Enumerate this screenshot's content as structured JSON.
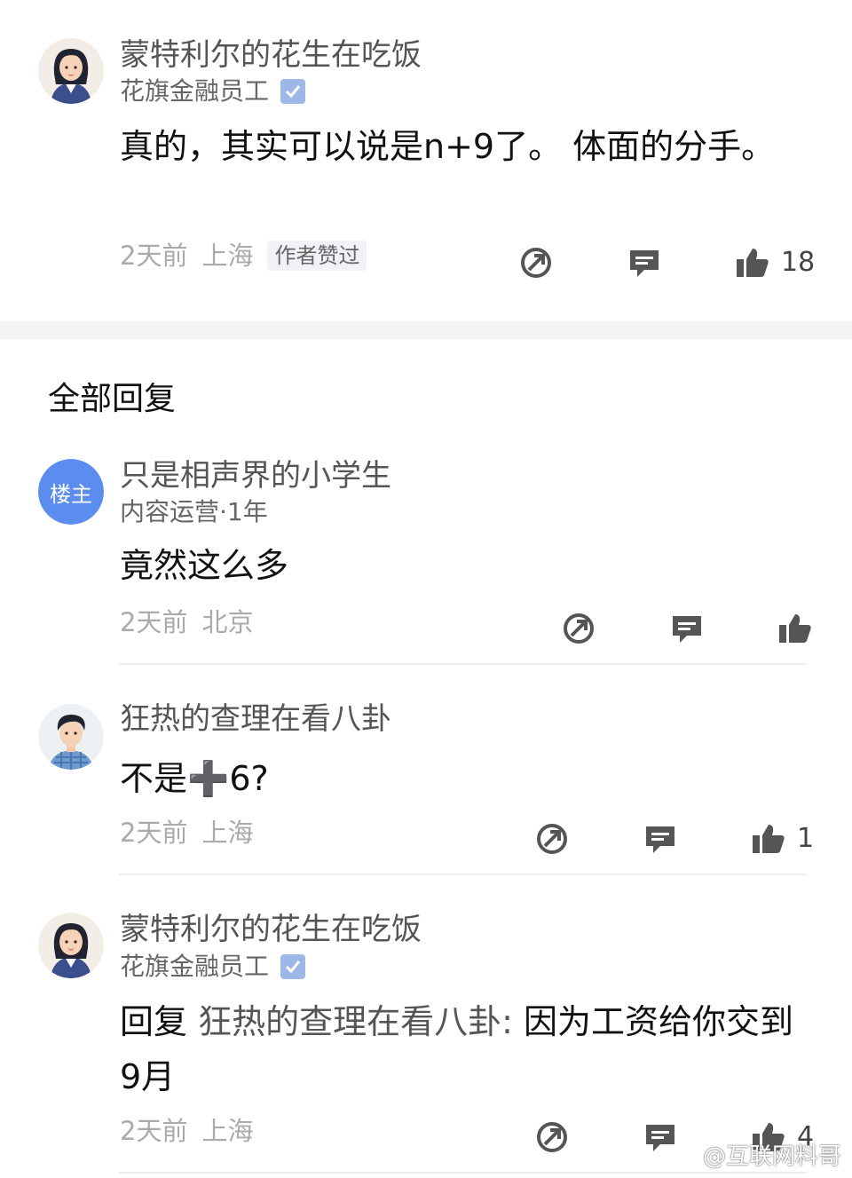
{
  "comment_main": {
    "user": "蒙特利尔的花生在吃饭",
    "company": "花旗金融员工",
    "text": "真的，其实可以说是n+9了。 体面的分手。",
    "time": "2天前",
    "location": "上海",
    "badge": "作者赞过",
    "likes": "18"
  },
  "section_title": "全部回复",
  "replies": [
    {
      "user": "只是相声界的小学生",
      "avatar_label": "楼主",
      "subtitle": "内容运营·1年",
      "text": "竟然这么多",
      "time": "2天前",
      "location": "北京",
      "likes": ""
    },
    {
      "user": "狂热的查理在看八卦",
      "text": "不是➕6?",
      "time": "2天前",
      "location": "上海",
      "likes": "1"
    },
    {
      "user": "蒙特利尔的花生在吃饭",
      "company": "花旗金融员工",
      "reply_prefix": "回复",
      "reply_target": "狂热的查理在看八卦:",
      "text": "因为工资给你交到9月",
      "time": "2天前",
      "location": "上海",
      "likes": "4"
    }
  ],
  "icons": {
    "share": "share-icon",
    "comment": "comment-icon",
    "like": "thumbs-up-icon",
    "verified": "verified-icon"
  },
  "colors": {
    "owner_badge": "#5b8def",
    "verified": "#9db8e6",
    "icon": "#555555",
    "meta": "#aaaaaa"
  },
  "watermark": "@互联网料哥"
}
